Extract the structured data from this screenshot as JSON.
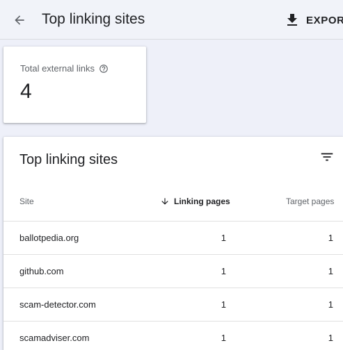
{
  "header": {
    "title": "Top linking sites",
    "export_label": "EXPORT"
  },
  "summary": {
    "label": "Total external links",
    "value": "4"
  },
  "table": {
    "title": "Top linking sites",
    "columns": {
      "site": "Site",
      "linking_pages": "Linking pages",
      "target_pages": "Target pages"
    },
    "sort": {
      "column": "linking_pages",
      "direction": "descending"
    },
    "rows": [
      {
        "site": "ballotpedia.org",
        "linking_pages": "1",
        "target_pages": "1"
      },
      {
        "site": "github.com",
        "linking_pages": "1",
        "target_pages": "1"
      },
      {
        "site": "scam-detector.com",
        "linking_pages": "1",
        "target_pages": "1"
      },
      {
        "site": "scamadviser.com",
        "linking_pages": "1",
        "target_pages": "1"
      }
    ]
  },
  "icons": {
    "back": "arrow-back-icon",
    "export": "download-icon",
    "help": "help-circle-icon",
    "filter": "filter-icon",
    "sort": "arrow-down-icon"
  },
  "colors": {
    "page_background": "#eef0f9",
    "text_primary": "#202124",
    "text_secondary": "#5f6368",
    "divider": "#e0e0e0"
  }
}
